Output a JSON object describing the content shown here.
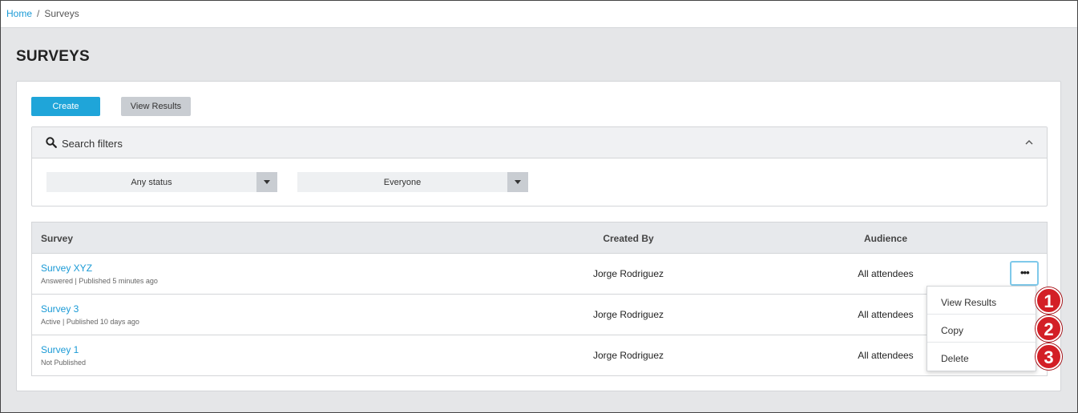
{
  "breadcrumb": {
    "home": "Home",
    "separator": "/",
    "current": "Surveys"
  },
  "page": {
    "title": "SURVEYS"
  },
  "toolbar": {
    "create_label": "Create",
    "view_results_label": "View Results"
  },
  "filters": {
    "title": "Search filters",
    "status_value": "Any status",
    "audience_value": "Everyone"
  },
  "table": {
    "columns": [
      "Survey",
      "Created By",
      "Audience"
    ],
    "rows": [
      {
        "name": "Survey XYZ",
        "meta": "Answered | Published 5 minutes ago",
        "created_by": "Jorge Rodriguez",
        "audience": "All attendees"
      },
      {
        "name": "Survey 3",
        "meta": "Active | Published 10 days ago",
        "created_by": "Jorge Rodriguez",
        "audience": "All attendees"
      },
      {
        "name": "Survey 1",
        "meta": "Not Published",
        "created_by": "Jorge Rodriguez",
        "audience": "All attendees"
      }
    ]
  },
  "row_menu": {
    "more_label": "•••",
    "items": [
      "View Results",
      "Copy",
      "Delete"
    ]
  },
  "callouts": [
    "1",
    "2",
    "3"
  ],
  "colors": {
    "primary": "#1fa5d9",
    "link": "#1a9ad6",
    "callout": "#d31f26",
    "secondary_button": "#c9cdd2"
  }
}
